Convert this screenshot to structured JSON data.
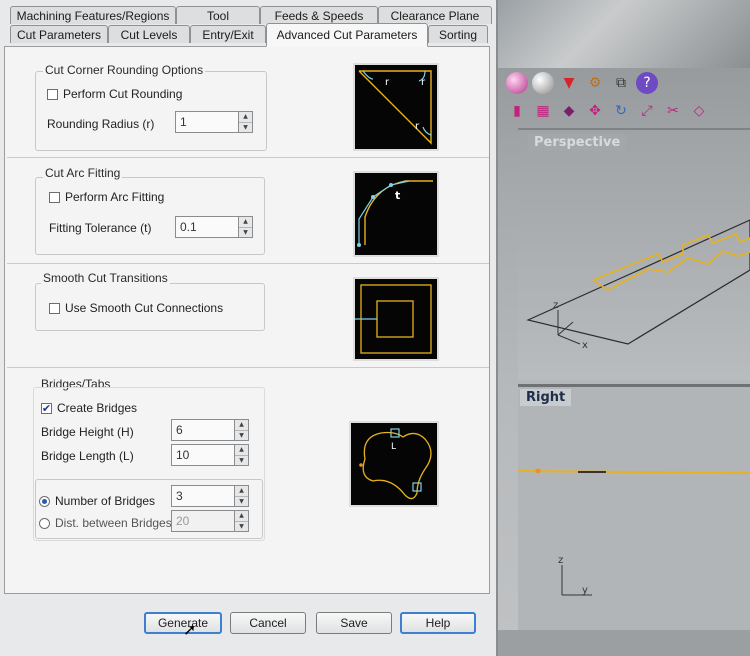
{
  "tabs_row1": [
    "Machining Features/Regions",
    "Tool",
    "Feeds & Speeds",
    "Clearance Plane"
  ],
  "tabs_row2": [
    "Cut Parameters",
    "Cut Levels",
    "Entry/Exit",
    "Advanced Cut Parameters",
    "Sorting"
  ],
  "active_tab": "Advanced Cut Parameters",
  "corner": {
    "title": "Cut Corner Rounding Options",
    "checkbox_label": "Perform Cut Rounding",
    "checked": false,
    "field_label": "Rounding Radius (r)",
    "field_value": "1",
    "preview_label": "r"
  },
  "arc": {
    "title": "Cut Arc Fitting",
    "checkbox_label": "Perform Arc Fitting",
    "checked": false,
    "field_label": "Fitting Tolerance (t)",
    "field_value": "0.1",
    "preview_label": "t"
  },
  "smooth": {
    "title": "Smooth Cut Transitions",
    "checkbox_label": "Use Smooth Cut Connections",
    "checked": false
  },
  "bridges": {
    "title": "Bridges/Tabs",
    "checkbox_label": "Create Bridges",
    "checked": true,
    "height_label": "Bridge Height (H)",
    "height_value": "6",
    "length_label": "Bridge Length (L)",
    "length_value": "10",
    "radio_count_label": "Number of Bridges",
    "radio_count_value": "3",
    "radio_dist_label": "Dist. between Bridges",
    "radio_dist_value": "20",
    "selected_radio": "count",
    "preview_label": "L"
  },
  "buttons": {
    "generate": "Generate",
    "cancel": "Cancel",
    "save": "Save",
    "help": "Help"
  },
  "viewport": {
    "perspective_label": "Perspective",
    "right_label": "Right"
  },
  "colors": {
    "preview_line": "#e8b21c",
    "preview_accent": "#7fd1e6"
  }
}
